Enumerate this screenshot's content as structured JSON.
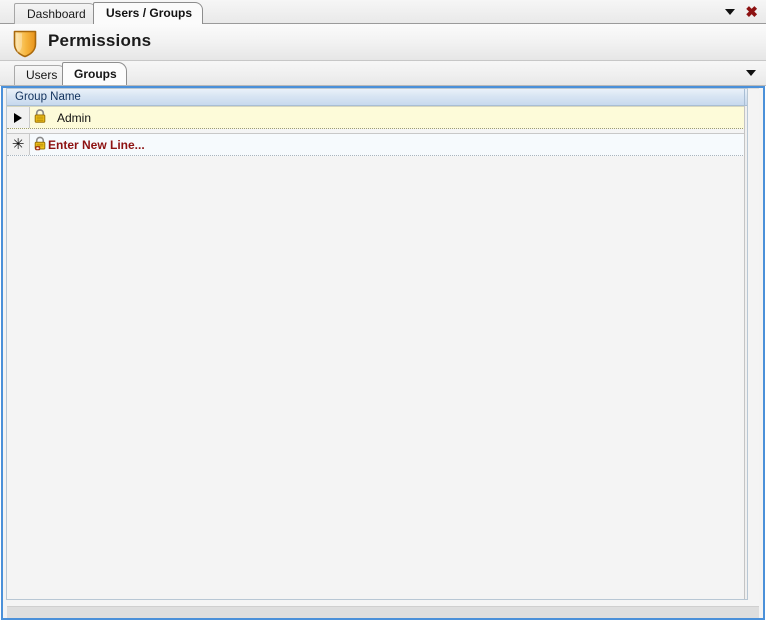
{
  "window": {
    "tabs": [
      {
        "label": "Dashboard",
        "active": false
      },
      {
        "label": "Users / Groups",
        "active": true
      }
    ],
    "controls": {
      "dropdown_icon": "chevron-down-icon",
      "close_icon": "close-icon",
      "close_glyph": "✖"
    }
  },
  "header": {
    "icon": "shield-icon",
    "title": "Permissions"
  },
  "inner_tabs": {
    "items": [
      {
        "label": "Users",
        "active": false
      },
      {
        "label": "Groups",
        "active": true
      }
    ],
    "overflow_icon": "chevron-down-icon"
  },
  "grid": {
    "columns": [
      {
        "label": "Group Name"
      }
    ],
    "rows": [
      {
        "selector": "▶",
        "selector_name": "current-row-indicator",
        "icon": "lock-icon",
        "name": "Admin",
        "state": "selected"
      },
      {
        "selector": "✳",
        "selector_name": "new-row-indicator",
        "icon": "lock-add-icon",
        "name": "Enter New Line...",
        "state": "new"
      }
    ]
  },
  "colors": {
    "accent_border": "#4a90d9",
    "selected_row": "#fdfbd9",
    "new_row_text": "#8d1212",
    "header_text": "#11315c",
    "shield_gold": "#f5a623"
  }
}
